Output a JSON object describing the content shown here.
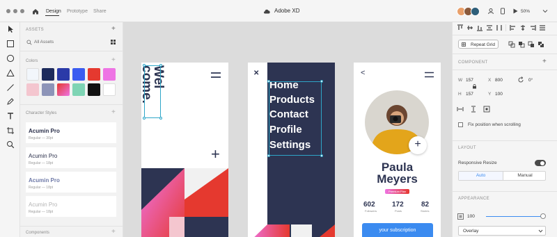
{
  "window": {
    "title": "Adobe XD"
  },
  "tabs": [
    {
      "label": "Design",
      "active": true
    },
    {
      "label": "Prototype",
      "active": false
    },
    {
      "label": "Share",
      "active": false
    }
  ],
  "toolbar": {
    "zoom": "50%"
  },
  "colors": {
    "accent": "#2ea6c8",
    "navy": "#2d3452",
    "highlight_blue": "#3b8bf0",
    "red": "#e53b2c",
    "pink": "#ee74e4"
  },
  "assets": {
    "header": "ASSETS",
    "search_label": "All Assets",
    "colors_header": "Colors",
    "swatches": [
      "#f2f6fb",
      "#1e2b5c",
      "#2b3aa8",
      "#3b5cf0",
      "#e5392f",
      "#ee74e4",
      "#f4c6cf",
      "#8d94b8",
      "gradient",
      "#7ed4b4",
      "#111111",
      "#ffffff"
    ],
    "character_styles_header": "Character Styles",
    "character_styles": [
      {
        "name": "Acumin Pro",
        "meta": "Regular — 30pt"
      },
      {
        "name": "Acumin Pro",
        "meta": "Regular — 18pt"
      },
      {
        "name": "Acumin Pro",
        "meta": "Regular — 18pt"
      },
      {
        "name": "Acumin Pro",
        "meta": "Regular — 18pt"
      }
    ],
    "components_header": "Components"
  },
  "artboard1": {
    "line1": "Wel",
    "line2": "come.",
    "plus": "+"
  },
  "artboard2": {
    "close": "✕",
    "menu": [
      "Home",
      "Products",
      "Contact",
      "Profile",
      "Settings"
    ]
  },
  "artboard3": {
    "back": "<",
    "first_name": "Paula",
    "last_name": "Meyers",
    "badge": "Premium Plan",
    "stats": [
      {
        "value": "602",
        "label": "Followers"
      },
      {
        "value": "172",
        "label": "Posts"
      },
      {
        "value": "82",
        "label": "Stories"
      }
    ],
    "cta": "your subscription"
  },
  "properties": {
    "repeat_grid": "Repeat Grid",
    "component_header": "COMPONENT",
    "w_label": "W",
    "w_value": "157",
    "x_label": "X",
    "x_value": "800",
    "h_label": "H",
    "h_value": "157",
    "y_label": "Y",
    "y_value": "100",
    "rotation": "0°",
    "fix_position": "Fix position when scrolling",
    "layout_header": "LAYOUT",
    "responsive_resize": "Responsive Resize",
    "resize_auto": "Auto",
    "resize_manual": "Manual",
    "appearance_header": "APPEARANCE",
    "opacity": "100",
    "opacity_fraction": 1.0,
    "blend_mode": "Overlay"
  }
}
